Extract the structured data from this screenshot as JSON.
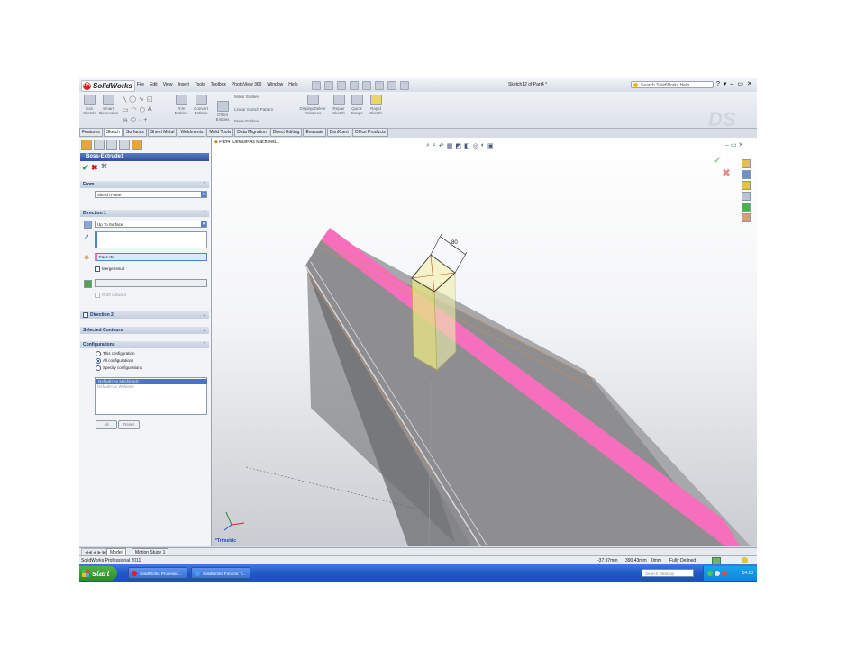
{
  "app": {
    "logo_text": "SolidWorks",
    "document_title": "Sketch12 of Part4 *",
    "search_placeholder": "Search SolidWorks Help",
    "menu": [
      "File",
      "Edit",
      "View",
      "Insert",
      "Tools",
      "Toolbox",
      "PhotoView 360",
      "Window",
      "Help"
    ],
    "window_controls": [
      "?",
      "▾",
      "–",
      "▭",
      "✕"
    ]
  },
  "command_manager": {
    "buttons": [
      {
        "label": "Exit Sketch",
        "icon": "exit-sketch-icon"
      },
      {
        "label": "Smart Dimension",
        "icon": "smart-dimension-icon"
      },
      {
        "label": "Trim Entities",
        "icon": "trim-icon"
      },
      {
        "label": "Convert Entities",
        "icon": "convert-icon"
      },
      {
        "label": "Offset Entities",
        "icon": "offset-icon"
      },
      {
        "label": "Mirror Entities",
        "icon": "mirror-icon"
      },
      {
        "label": "Linear Sketch Pattern",
        "icon": "linear-pattern-icon"
      },
      {
        "label": "Move Entities",
        "icon": "move-icon"
      },
      {
        "label": "Display/Delete Relations",
        "icon": "relations-icon"
      },
      {
        "label": "Repair Sketch",
        "icon": "repair-icon"
      },
      {
        "label": "Quick Snaps",
        "icon": "snap-icon"
      },
      {
        "label": "Rapid Sketch",
        "icon": "rapid-sketch-icon"
      }
    ]
  },
  "tabs": [
    "Features",
    "Sketch",
    "Surfaces",
    "Sheet Metal",
    "Weldments",
    "Mold Tools",
    "Data Migration",
    "Direct Editing",
    "Evaluate",
    "DimXpert",
    "Office Products"
  ],
  "active_tab": "Sketch",
  "property_manager": {
    "title": "Boss-Extrude1",
    "from": {
      "header": "From",
      "value": "Sketch Plane"
    },
    "direction1": {
      "header": "Direction 1",
      "end_condition": "Up To Surface",
      "face": "Face<1>",
      "merge_result": "Merge result",
      "draft_outward": "Draft outward"
    },
    "direction2": {
      "header": "Direction 2"
    },
    "selected_contours": {
      "header": "Selected Contours"
    },
    "configurations": {
      "header": "Configurations",
      "options": [
        "This configuration",
        "All configurations",
        "Specify configurations"
      ],
      "selected_option": 1,
      "list": [
        "Default<As Machined>",
        "Default<As Welded>"
      ],
      "buttons": [
        "All",
        "Reset"
      ]
    }
  },
  "viewport": {
    "tree_title": "Part4  (Default<As Machined...",
    "dimension": "80",
    "view_name": "*Trimetric",
    "colors": {
      "face_pink": "#f56fbd",
      "beam_gray": "#8e8e90",
      "extrude_yellow": "#e7e685"
    }
  },
  "bottom_tabs": [
    "Model",
    "Motion Study 1"
  ],
  "status": {
    "product": "SolidWorks Professional 2011",
    "x": "-37.97mm",
    "y": "390.43mm",
    "z": "0mm",
    "state": "Fully Defined"
  },
  "taskbar": {
    "start": "start",
    "tasks": [
      "SolidWorks Professio...",
      "SolidWorks Forums: T..."
    ],
    "search": "Search Desktop",
    "clock": "14:13"
  }
}
